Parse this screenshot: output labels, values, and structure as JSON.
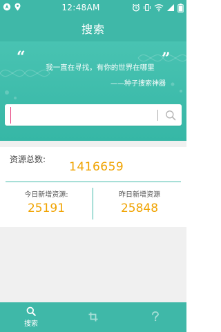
{
  "status_bar": {
    "time": "12:48AM"
  },
  "header": {
    "title": "搜索"
  },
  "banner": {
    "quote_open": "“",
    "quote_close": "”",
    "quote": "我一直在寻找，有你的世界在哪里",
    "author": "——种子搜索神器"
  },
  "search": {
    "value": "",
    "placeholder": ""
  },
  "stats": {
    "total_label": "资源总数:",
    "total_value": "1416659",
    "today_label": "今日新增资源:",
    "today_value": "25191",
    "yesterday_label": "昨日新增资源",
    "yesterday_value": "25848"
  },
  "bottom_nav": {
    "items": [
      {
        "label": "搜索",
        "icon": "search-icon",
        "active": true
      },
      {
        "label": "",
        "icon": "crop-icon",
        "active": false
      },
      {
        "label": "",
        "icon": "help-icon",
        "active": false
      }
    ]
  },
  "colors": {
    "primary": "#3fb8a8",
    "accent": "#f0a300",
    "background": "#f0f0f0"
  }
}
